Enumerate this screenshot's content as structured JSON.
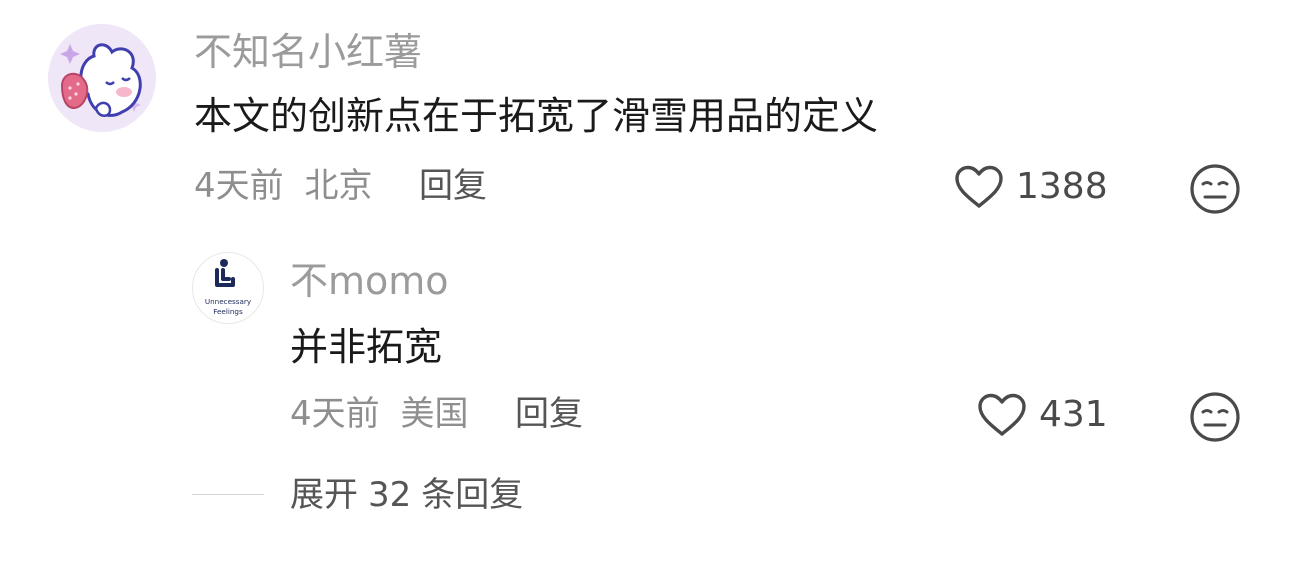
{
  "comment": {
    "username": "不知名小红薯",
    "text": "本文的创新点在于拓宽了滑雪用品的定义",
    "time": "4天前",
    "location": "北京",
    "reply_label": "回复",
    "likes": "1388",
    "avatar_icon": "cartoon-bunny-avatar",
    "like_icon": "heart-outline-icon",
    "dislike_icon": "unamused-face-icon"
  },
  "reply": {
    "username": "不momo",
    "text": "并非拓宽",
    "time": "4天前",
    "location": "美国",
    "reply_label": "回复",
    "likes": "431",
    "avatar_text_line1": "Unnecessary",
    "avatar_text_line2": "Feelings",
    "avatar_icon": "person-at-laptop-logo",
    "like_icon": "heart-outline-icon",
    "dislike_icon": "unamused-face-icon"
  },
  "expand": {
    "label_prefix": "展开",
    "count": "32",
    "label_suffix": "条回复"
  },
  "colors": {
    "username": "#9b9b9b",
    "text": "#1a1a1a",
    "meta": "#8e8e8e",
    "action": "#555555",
    "icon": "#4a4a4a"
  }
}
